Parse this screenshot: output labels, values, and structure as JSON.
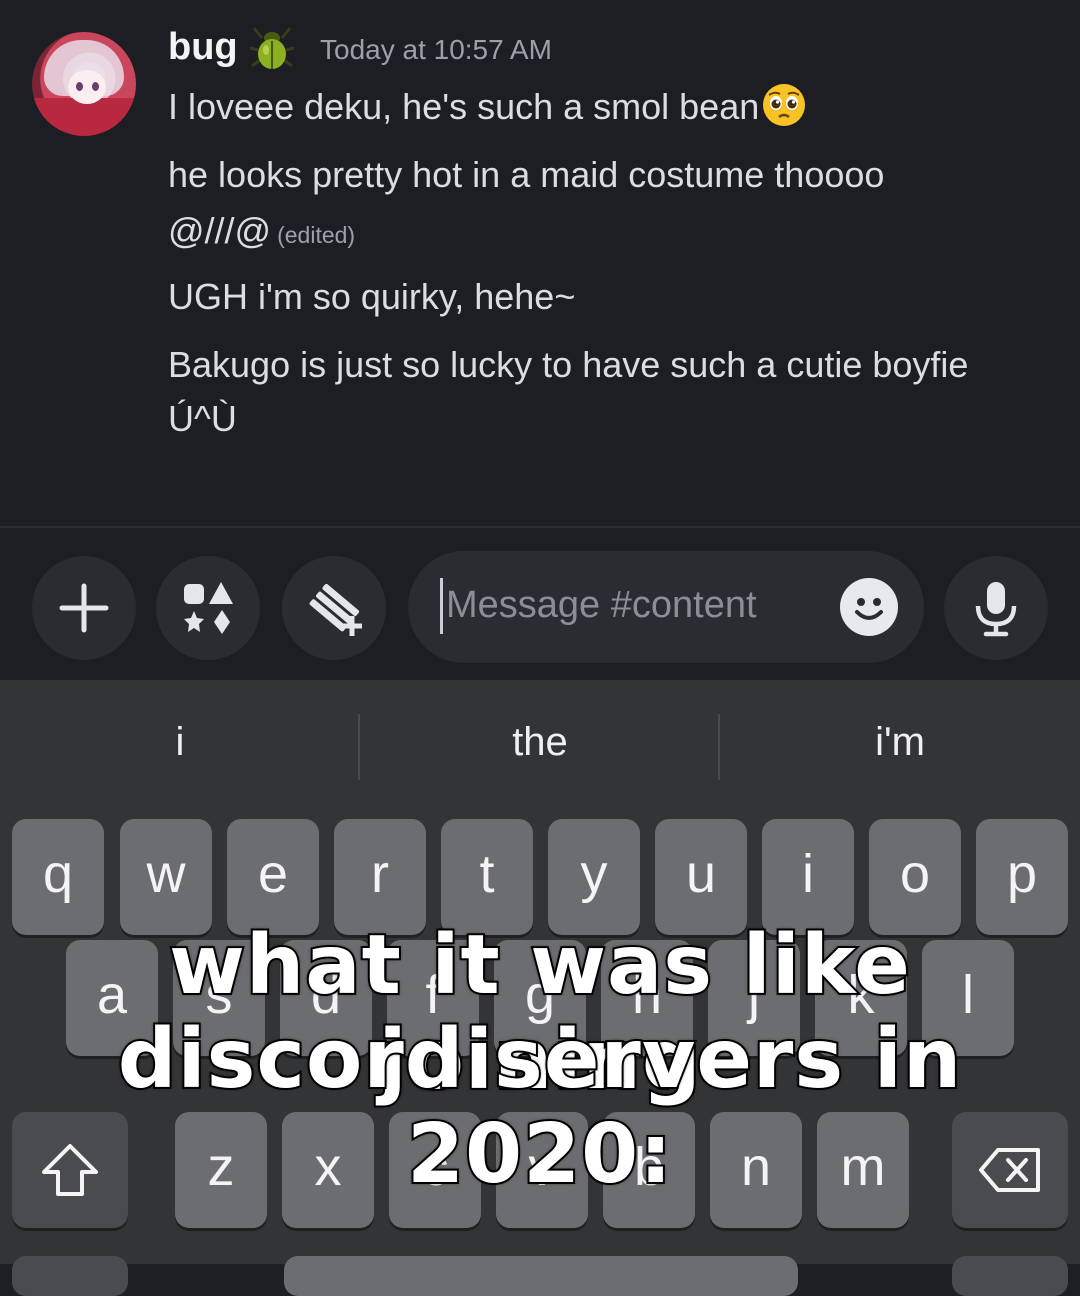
{
  "message": {
    "username": "bug",
    "timestamp": "Today at 10:57 AM",
    "lines": [
      "I loveee deku, he's such a smol bean",
      "he looks pretty hot in a maid costume thoooo",
      "@///@",
      "UGH i'm so quirky, hehe~",
      "Bakugo is just so lucky to have such a cutie boyfie",
      "Ú^Ù"
    ],
    "edited_label": "(edited)"
  },
  "input": {
    "placeholder": "Message #content"
  },
  "icons": [
    "plus-icon",
    "apps-icon",
    "gift-icon",
    "emoji-icon",
    "microphone-icon",
    "shift-icon",
    "backspace-icon"
  ],
  "keyboard": {
    "suggestions": [
      "i",
      "the",
      "i'm"
    ],
    "row1": [
      "q",
      "w",
      "e",
      "r",
      "t",
      "y",
      "u",
      "i",
      "o",
      "p"
    ],
    "row2": [
      "a",
      "s",
      "d",
      "f",
      "g",
      "h",
      "j",
      "k",
      "l"
    ],
    "row3": [
      "z",
      "x",
      "c",
      "v",
      "b",
      "n",
      "m"
    ]
  },
  "caption": {
    "line1": "what it was like joining",
    "line2": "discord servers in 2020:"
  },
  "colors": {
    "chat_bg": "#1d1e24",
    "keyboard_bg": "#333436",
    "key": "#6c6d70"
  }
}
